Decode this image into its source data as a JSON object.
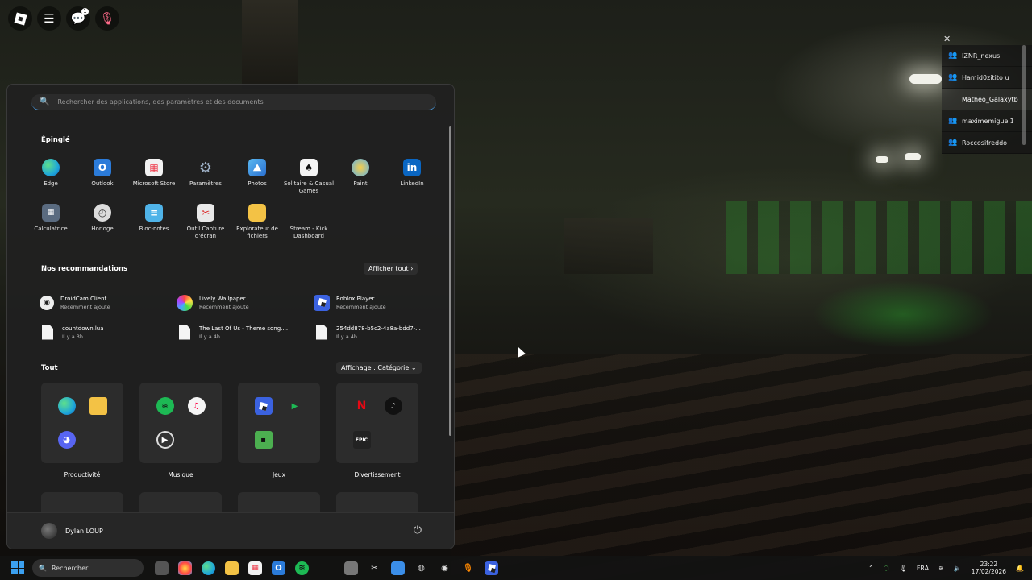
{
  "search": {
    "placeholder": "Rechercher des applications, des paramètres et des documents"
  },
  "pinned": {
    "title": "Épinglé",
    "apps": [
      {
        "label": "Edge",
        "icon": "edge-icon",
        "color": "#1fa7d8"
      },
      {
        "label": "Outlook",
        "icon": "outlook-icon",
        "color": "#2b7bd9"
      },
      {
        "label": "Microsoft Store",
        "icon": "store-icon",
        "color": "#f2f2f2"
      },
      {
        "label": "Paramètres",
        "icon": "settings-icon",
        "color": "#8a9bb0"
      },
      {
        "label": "Photos",
        "icon": "photos-icon",
        "color": "#3b8ee8"
      },
      {
        "label": "Solitaire & Casual Games",
        "icon": "solitaire-icon",
        "color": "#f4f4f4"
      },
      {
        "label": "Paint",
        "icon": "paint-icon",
        "color": "#5ab0e8"
      },
      {
        "label": "LinkedIn",
        "icon": "linkedin-icon",
        "color": "#0a66c2"
      },
      {
        "label": "Calculatrice",
        "icon": "calculator-icon",
        "color": "#5a6b80"
      },
      {
        "label": "Horloge",
        "icon": "clock-icon",
        "color": "#dcdcdc"
      },
      {
        "label": "Bloc-notes",
        "icon": "notepad-icon",
        "color": "#4fb3e8"
      },
      {
        "label": "Outil Capture d'écran",
        "icon": "snipping-tool-icon",
        "color": "#e8e8e8"
      },
      {
        "label": "Explorateur de fichiers",
        "icon": "folder-icon",
        "color": "#f3c245"
      },
      {
        "label": "Stream - Kick Dashboard",
        "icon": "kick-icon",
        "color": "#2a2a2a"
      }
    ]
  },
  "recommendations": {
    "title": "Nos recommandations",
    "link": "Afficher tout",
    "items": [
      {
        "name": "DroidCam Client",
        "sub": "Récemment ajouté",
        "icon": "droidcam-icon"
      },
      {
        "name": "Lively Wallpaper",
        "sub": "Récemment ajouté",
        "icon": "lively-wallpaper-icon"
      },
      {
        "name": "Roblox Player",
        "sub": "Récemment ajouté",
        "icon": "roblox-icon"
      },
      {
        "name": "countdown.lua",
        "sub": "Il y a 3h",
        "icon": "file-icon"
      },
      {
        "name": "The Last Of Us - Theme song....",
        "sub": "Il y a 4h",
        "icon": "file-icon"
      },
      {
        "name": "254dd878-b5c2-4a8a-bdd7-...",
        "sub": "Il y a 4h",
        "icon": "file-icon"
      }
    ]
  },
  "all": {
    "title": "Tout",
    "view": "Affichage : Catégorie",
    "categories": [
      {
        "label": "Productivité"
      },
      {
        "label": "Musique"
      },
      {
        "label": "Jeux"
      },
      {
        "label": "Divertissement"
      }
    ]
  },
  "user": {
    "name": "Dylan LOUP"
  },
  "players": [
    "IZNR_nexus",
    "Hamid0zitito u",
    "Matheo_Galaxytb",
    "maximemiguel1",
    "Roccosifreddo"
  ],
  "taskbar": {
    "search": "Rechercher",
    "lang": "FRA",
    "time": "23:22",
    "date": "17/02/2026"
  }
}
